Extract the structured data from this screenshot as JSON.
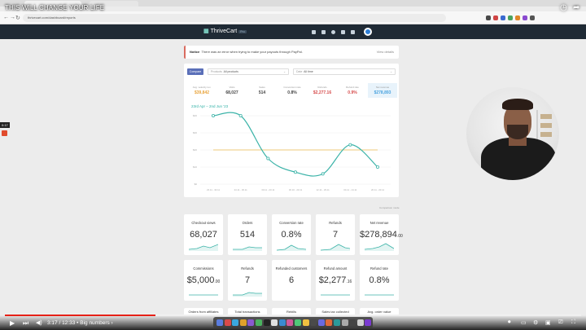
{
  "video": {
    "title": "THIS WILL CHANGE YOUR LIFE",
    "time": "3:17 / 12:33",
    "chapter": "• Big numbers",
    "chapter_arrow": "›",
    "side_time": "0:17",
    "progress_fraction": 0.261
  },
  "browser": {
    "url": "thrivecart.com/dashboard/reports"
  },
  "app": {
    "logo": "ThriveCart",
    "logo_badge": "Pro"
  },
  "notice": {
    "label": "Notice",
    "text": "There was an error when trying to make your payouts through PayPal.",
    "button": "View details"
  },
  "filters": {
    "compare_label": "Compare",
    "products_label": "Products",
    "products_value": "All products",
    "date_label": "Date",
    "date_value": "All time"
  },
  "metrics": [
    {
      "label": "Avg. velocity rev.",
      "value": "$39,842",
      "color": "#e8a33a"
    },
    {
      "label": "Visits",
      "value": "68,027",
      "color": "#444444"
    },
    {
      "label": "Sales",
      "value": "514",
      "color": "#444444"
    },
    {
      "label": "Conversion rate",
      "value": "0.8%",
      "color": "#444444"
    },
    {
      "label": "Refunds",
      "value": "$2,277.16",
      "color": "#d64a4a"
    },
    {
      "label": "Refund rate",
      "value": "0.9%",
      "color": "#d64a4a"
    },
    {
      "label": "Net revenue",
      "value": "$278,893",
      "color": "#4aa3df"
    }
  ],
  "chart_range": "23rd Apr – 2nd Jun '23",
  "chart_data": {
    "type": "line",
    "categories": [
      "23.11 - 30.11",
      "24.11 - 30.11",
      "30.11 - 20.11",
      "30.10 - 20.11",
      "12.11 - 29.11",
      "04.11 - 14.11",
      "20.11 - 20.11"
    ],
    "series": [
      {
        "values": [
          40,
          40,
          15,
          7,
          6,
          23,
          10
        ],
        "color": "#3bb3a8"
      }
    ],
    "reference": {
      "value": 20,
      "color": "#e8b84f"
    },
    "y_ticks": [
      "$0",
      "$10",
      "$20",
      "$30",
      "$40"
    ],
    "ylim": [
      0,
      40
    ],
    "grid": true
  },
  "chart_footer": "Comparison mode",
  "cards_row1": [
    {
      "label": "Checkout views",
      "value": "68,027",
      "unit": ""
    },
    {
      "label": "Orders",
      "value": "514",
      "unit": ""
    },
    {
      "label": "Conversion rate",
      "value": "0.8%",
      "unit": ""
    },
    {
      "label": "Refunds",
      "value": "7",
      "unit": ""
    },
    {
      "label": "Net revenue",
      "value": "$278,894",
      "unit": ".00"
    }
  ],
  "cards_row2": [
    {
      "label": "Commissions",
      "value": "$5,000",
      "unit": ".00"
    },
    {
      "label": "Refunds",
      "value": "7",
      "unit": ""
    },
    {
      "label": "Refunded customers",
      "value": "6",
      "unit": ""
    },
    {
      "label": "Refund amount",
      "value": "$2,277",
      "unit": ".16"
    },
    {
      "label": "Refund rate",
      "value": "0.8%",
      "unit": ""
    }
  ],
  "cards_row3": [
    "Orders from affiliates",
    "Total transactions",
    "Rebills",
    "Sales tax collected",
    "Avg. order value"
  ],
  "accent": "#3bb3a8"
}
